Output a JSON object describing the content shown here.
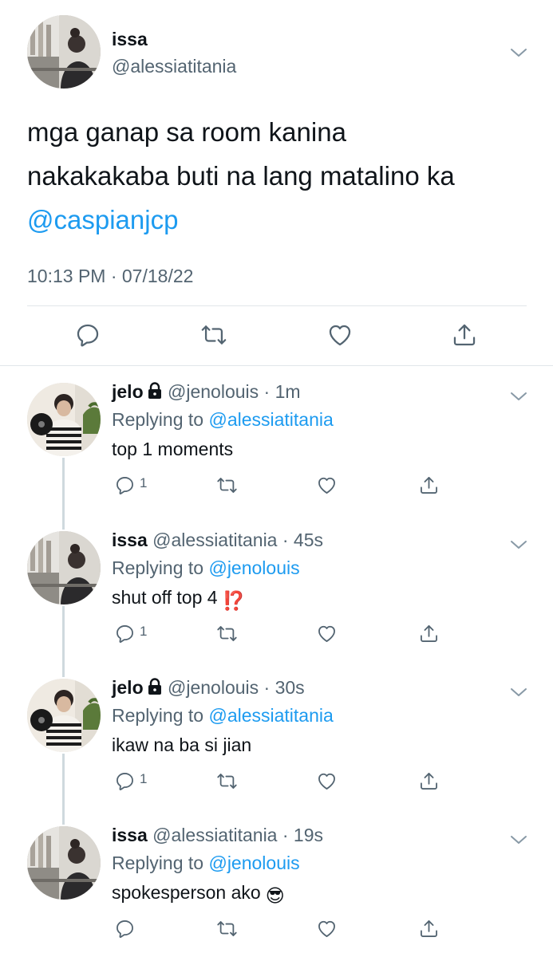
{
  "main_tweet": {
    "name": "issa",
    "handle": "@alessiatitania",
    "text_line1": "mga ganap sa room kanina",
    "text_line2": "nakakakaba buti na lang matalino ka",
    "mention": "@caspianjcp",
    "timestamp": "10:13 PM · 07/18/22"
  },
  "replies": [
    {
      "name": "jelo",
      "handle": "@jenolouis",
      "time": "· 1m",
      "replying_prefix": "Replying to ",
      "replying_to": "@alessiatitania",
      "text": "top 1 moments",
      "reply_count": "1"
    },
    {
      "name": "issa",
      "handle": "@alessiatitania",
      "time": "· 45s",
      "replying_prefix": "Replying to ",
      "replying_to": "@jenolouis",
      "text": "shut off top 4",
      "emoji": "⁉️",
      "reply_count": "1"
    },
    {
      "name": "jelo",
      "handle": "@jenolouis",
      "time": "· 30s",
      "replying_prefix": "Replying to ",
      "replying_to": "@alessiatitania",
      "text": "ikaw na ba si jian",
      "reply_count": "1"
    },
    {
      "name": "issa",
      "handle": "@alessiatitania",
      "time": "· 19s",
      "replying_prefix": "Replying to ",
      "replying_to": "@jenolouis",
      "text": "spokesperson ako",
      "emoji": "😎",
      "reply_count": ""
    }
  ],
  "icons": {
    "reply": "reply-icon",
    "retweet": "retweet-icon",
    "like": "heart-icon",
    "share": "share-icon",
    "more": "chevron-down-icon",
    "protected": "lock-icon"
  },
  "colors": {
    "accent": "#1d9bf0",
    "secondary_text": "#536471",
    "primary_text": "#0f1419",
    "divider": "#e1e6ea",
    "thread_line": "#cfd9de"
  }
}
